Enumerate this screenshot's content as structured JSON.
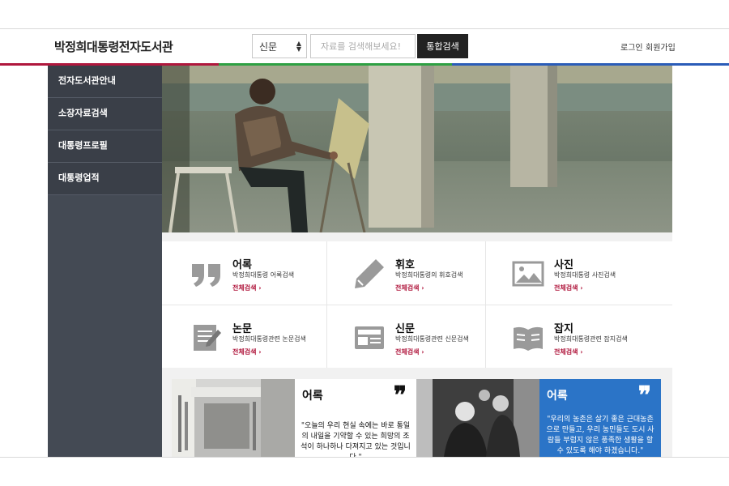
{
  "header": {
    "brand": "박정희대통령전자도서관",
    "search_select_value": "신문",
    "search_placeholder": "자료를 검색해보세요!",
    "search_button": "통합검색",
    "login": "로그인",
    "join": "회원가입"
  },
  "colors": {
    "accent_red": "#b0173d",
    "accent_green": "#2ea043",
    "accent_blue": "#2a5cb8",
    "sidebar": "#3a3f48",
    "quote_blue": "#2b74c7"
  },
  "sidebar": {
    "items": [
      {
        "label": "전자도서관안내"
      },
      {
        "label": "소장자료검색"
      },
      {
        "label": "대통령프로필"
      },
      {
        "label": "대통령업적"
      }
    ]
  },
  "categories": [
    {
      "title": "어록",
      "desc": "박정희대통령 어록검색",
      "link": "전체검색 ›",
      "icon": "quote-icon"
    },
    {
      "title": "휘호",
      "desc": "박정희대통령의 휘호검색",
      "link": "전체검색 ›",
      "icon": "pen-icon"
    },
    {
      "title": "사진",
      "desc": "박정희대통령 사진검색",
      "link": "전체검색 ›",
      "icon": "image-icon"
    },
    {
      "title": "논문",
      "desc": "박정희대통령관련 논문검색",
      "link": "전체검색 ›",
      "icon": "document-icon"
    },
    {
      "title": "신문",
      "desc": "박정희대통령관련 신문검색",
      "link": "전체검색 ›",
      "icon": "newspaper-icon"
    },
    {
      "title": "잡지",
      "desc": "박정희대통령관련 잡지검색",
      "link": "전체검색 ›",
      "icon": "magazine-icon"
    }
  ],
  "quotes": [
    {
      "title": "어록",
      "text": "\"오늘의 우리 현실 속에는 바로 통일의 내일을 기약할 수 있는 희망의 조석이 하나하나 다져지고 있는 것입니다.\""
    },
    {
      "title": "어록",
      "text": "\"우리의 농촌은 살기 좋은 근대농촌으로 만들고, 우리 농민들도 도시 사람들 부럽지 않은 풍족한 생활을 할 수 있도록 해야 하겠습니다.\""
    }
  ]
}
